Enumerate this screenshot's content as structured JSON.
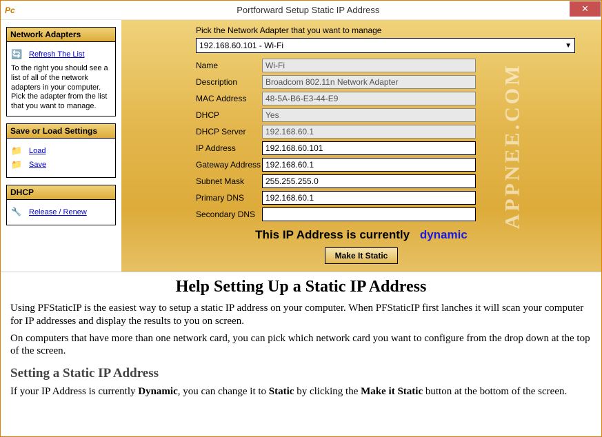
{
  "window": {
    "title": "Portforward Setup Static IP Address",
    "logo": "Pc"
  },
  "sidebar": {
    "adapters": {
      "title": "Network Adapters",
      "refresh_label": "Refresh The List",
      "instructions": "To the right you should see a list of all of the network adapters in your computer. Pick the adapter from the list that you want to manage."
    },
    "settings": {
      "title": "Save or Load Settings",
      "load_label": "Load",
      "save_label": "Save"
    },
    "dhcp": {
      "title": "DHCP",
      "renew_label": "Release / Renew"
    }
  },
  "adapter": {
    "prompt": "Pick the Network Adapter that you want to manage",
    "selected": "192.168.60.101 - Wi-Fi",
    "fields": {
      "name_label": "Name",
      "name": "Wi-Fi",
      "description_label": "Description",
      "description": "Broadcom 802.11n Network Adapter",
      "mac_label": "MAC Address",
      "mac": "48-5A-B6-E3-44-E9",
      "dhcp_label": "DHCP",
      "dhcp": "Yes",
      "dhcpserver_label": "DHCP Server",
      "dhcpserver": "192.168.60.1",
      "ip_label": "IP Address",
      "ip": "192.168.60.101",
      "gateway_label": "Gateway Address",
      "gateway": "192.168.60.1",
      "subnet_label": "Subnet Mask",
      "subnet": "255.255.255.0",
      "primarydns_label": "Primary DNS",
      "primarydns": "192.168.60.1",
      "secondarydns_label": "Secondary DNS",
      "secondarydns": ""
    },
    "status_prefix": "This IP Address is currently",
    "status_value": "dynamic",
    "make_static_label": "Make It Static"
  },
  "watermark": "APPNEE.COM",
  "help": {
    "h1": "Help Setting Up a Static IP Address",
    "p1": "Using PFStaticIP is the easiest way to setup a static IP address on your computer. When PFStaticIP first lanches it will scan your computer for IP addresses and display the results to you on screen.",
    "p2": "On computers that have more than one network card, you can pick which network card you want to configure from the drop down at the top of the screen.",
    "h2": "Setting a Static IP Address",
    "p3a": "If your IP Address is currently ",
    "p3b": "Dynamic",
    "p3c": ", you can change it to ",
    "p3d": "Static",
    "p3e": " by clicking the ",
    "p3f": "Make it Static",
    "p3g": " button at the bottom of the screen."
  }
}
